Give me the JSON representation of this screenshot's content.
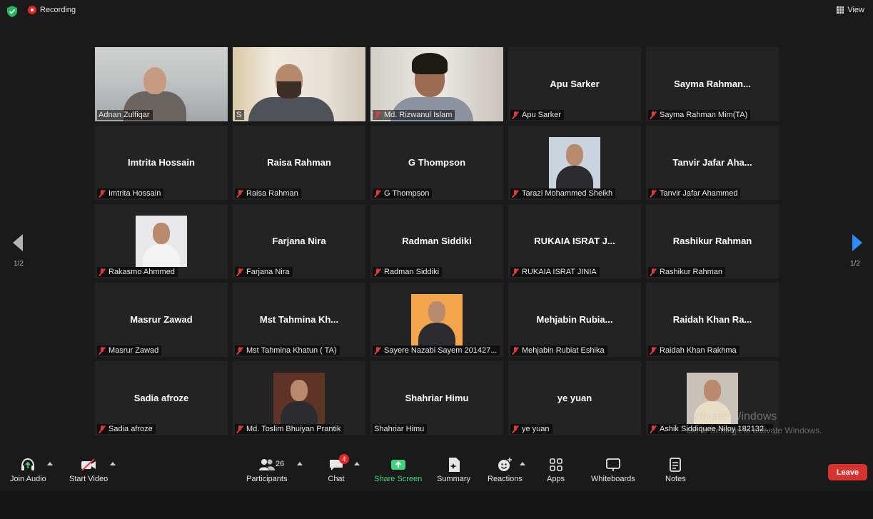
{
  "topbar": {
    "recording_label": "Recording",
    "view_label": "View"
  },
  "pagination": {
    "left": "1/2",
    "right": "1/2"
  },
  "participants": [
    {
      "display": "",
      "label": "Adnan Zulfiqar",
      "muted": false,
      "video": "v1"
    },
    {
      "display": "",
      "label": "S",
      "muted": false,
      "video": "v2"
    },
    {
      "display": "",
      "label": "Md. Rizwanul Islam",
      "muted": true,
      "video": "v3"
    },
    {
      "display": "Apu Sarker",
      "label": "Apu Sarker",
      "muted": true
    },
    {
      "display": "Sayma  Rahman...",
      "label": "Sayma Rahman Mim(TA)",
      "muted": true
    },
    {
      "display": "Imtrita Hossain",
      "label": "Imtrita Hossain",
      "muted": true
    },
    {
      "display": "Raisa Rahman",
      "label": "Raisa Rahman",
      "muted": true
    },
    {
      "display": "G Thompson",
      "label": "G Thompson",
      "muted": true
    },
    {
      "display": "",
      "label": "Tarazi Mohammed Sheikh",
      "muted": true,
      "avatar": "av-bg-1"
    },
    {
      "display": "Tanvir Jafar Aha...",
      "label": "Tanvir Jafar Ahammed",
      "muted": true
    },
    {
      "display": "",
      "label": "Rakasmo Ahmmed",
      "muted": true,
      "avatar": "av-bg-2"
    },
    {
      "display": "Farjana Nira",
      "label": "Farjana Nira",
      "muted": true
    },
    {
      "display": "Radman Siddiki",
      "label": "Radman Siddiki",
      "muted": true
    },
    {
      "display": "RUKAIA ISRAT J...",
      "label": "RUKAIA ISRAT JINIA",
      "muted": true
    },
    {
      "display": "Rashikur Rahman",
      "label": "Rashikur Rahman",
      "muted": true
    },
    {
      "display": "Masrur Zawad",
      "label": "Masrur Zawad",
      "muted": true
    },
    {
      "display": "Mst Tahmina Kh...",
      "label": "Mst Tahmina Khatun ( TA)",
      "muted": true
    },
    {
      "display": "",
      "label": "Sayere Nazabi Sayem 201427...",
      "muted": true,
      "avatar": "av-bg-3"
    },
    {
      "display": "Mehjabin  Rubia...",
      "label": "Mehjabin Rubiat Eshika",
      "muted": true
    },
    {
      "display": "Raidah  Khan  Ra...",
      "label": "Raidah Khan Rakhma",
      "muted": true
    },
    {
      "display": "Sadia afroze",
      "label": "Sadia afroze",
      "muted": true
    },
    {
      "display": "",
      "label": "Md. Toslim Bhuiyan Prantik",
      "muted": true,
      "avatar": "av-bg-4"
    },
    {
      "display": "Shahriar Himu",
      "label": "Shahriar Himu",
      "muted": false
    },
    {
      "display": "ye yuan",
      "label": "ye yuan",
      "muted": true
    },
    {
      "display": "",
      "label": "Ashik Siddiquee Niloy 182132...",
      "muted": true,
      "avatar": "av-bg-5"
    }
  ],
  "watermark": {
    "line1": "Activate Windows",
    "line2": "Go to Settings to activate Windows."
  },
  "toolbar": {
    "join_audio": "Join Audio",
    "start_video": "Start Video",
    "participants": "Participants",
    "participant_count": "26",
    "chat": "Chat",
    "chat_badge": "4",
    "share_screen": "Share Screen",
    "summary": "Summary",
    "reactions": "Reactions",
    "apps": "Apps",
    "whiteboards": "Whiteboards",
    "notes": "Notes",
    "leave": "Leave"
  },
  "colors": {
    "accent_green": "#3fd37a",
    "leave_red": "#d7332f",
    "active_speaker": "#b6e34a",
    "arrow_blue": "#2d8cff"
  }
}
